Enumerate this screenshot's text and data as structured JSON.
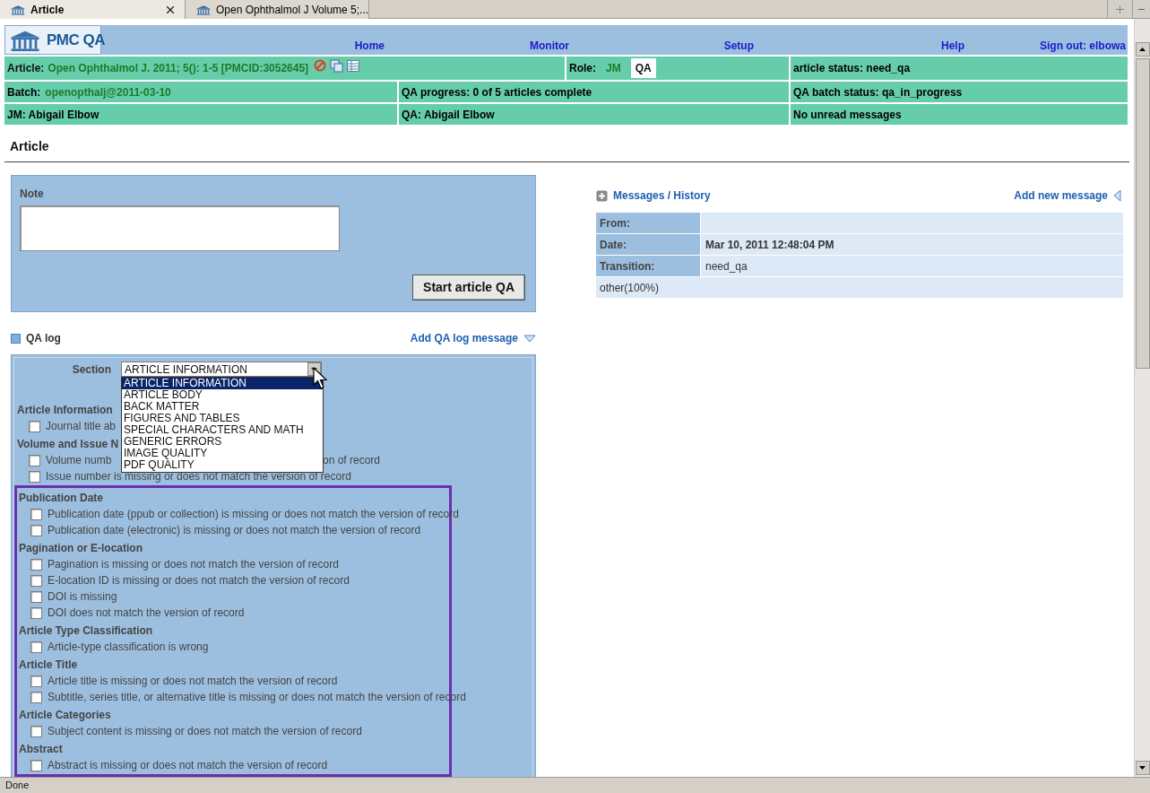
{
  "browser_tabs": [
    {
      "title": "Article",
      "selected": true
    },
    {
      "title": "Open Ophthalmol J Volume 5;...",
      "selected": false
    }
  ],
  "header": {
    "logo_text": "PMC QA",
    "nav": [
      "Home",
      "Monitor",
      "Setup",
      "Help",
      "Sign out: elbowa"
    ]
  },
  "info": {
    "article": {
      "label": "Article:",
      "value": "Open Ophthalmol J. 2011; 5(): 1-5 [PMCID:3052645]"
    },
    "role": {
      "label": "Role:",
      "options": [
        {
          "label": "JM",
          "selected": false
        },
        {
          "label": "QA",
          "selected": true
        }
      ]
    },
    "article_status": "article status: need_qa",
    "batch": {
      "label": "Batch:",
      "value": "openopthalj@2011-03-10"
    },
    "qa_progress": "QA progress: 0 of 5 articles complete",
    "qa_batch_status": "QA batch status: qa_in_progress",
    "jm": "JM: Abigail Elbow",
    "qa": "QA: Abigail Elbow",
    "messages_status": "No unread messages"
  },
  "page_title": "Article",
  "note": {
    "label": "Note",
    "button": "Start article QA"
  },
  "qa_log": {
    "title": "QA log",
    "add_link": "Add QA log message",
    "section_label": "Section",
    "section_select": {
      "value": "ARTICLE INFORMATION",
      "expanded": true,
      "options": [
        {
          "label": "ARTICLE INFORMATION",
          "selected": true
        },
        {
          "label": "ARTICLE BODY",
          "selected": false
        },
        {
          "label": "BACK MATTER",
          "selected": false
        },
        {
          "label": "FIGURES AND TABLES",
          "selected": false
        },
        {
          "label": "SPECIAL CHARACTERS AND MATH",
          "selected": false
        },
        {
          "label": "GENERIC ERRORS",
          "selected": false
        },
        {
          "label": "IMAGE QUALITY",
          "selected": false
        },
        {
          "label": "PDF QUALITY",
          "selected": false
        }
      ]
    },
    "sections": [
      {
        "heading": "Article Information",
        "highlighted": false,
        "items": [
          {
            "text": "Journal title ab",
            "checked": false
          }
        ]
      },
      {
        "heading": "Volume and Issue N",
        "highlighted": false,
        "items": [
          {
            "text": "Volume numb",
            "tail": "on of record",
            "checked": false
          },
          {
            "text": "Issue number is missing or does not match the version of record",
            "checked": false
          }
        ]
      },
      {
        "heading": "Publication Date",
        "highlighted": true,
        "items": [
          {
            "text": "Publication date (ppub or collection) is missing or does not match the version of record",
            "checked": false
          },
          {
            "text": "Publication date (electronic) is missing or does not match the version of record",
            "checked": false
          }
        ]
      },
      {
        "heading": "Pagination or E-location",
        "highlighted": true,
        "items": [
          {
            "text": "Pagination is missing or does not match the version of record",
            "checked": false
          },
          {
            "text": "E-location ID is missing or does not match the version of record",
            "checked": false
          },
          {
            "text": "DOI is missing",
            "checked": false
          },
          {
            "text": "DOI does not match the version of record",
            "checked": false
          }
        ]
      },
      {
        "heading": "Article Type Classification",
        "highlighted": true,
        "items": [
          {
            "text": "Article-type classification is wrong",
            "checked": false
          }
        ]
      },
      {
        "heading": "Article Title",
        "highlighted": true,
        "items": [
          {
            "text": "Article title is missing or does not match the version of record",
            "checked": false
          },
          {
            "text": "Subtitle, series title, or alternative title is missing or does not match the version of record",
            "checked": false
          }
        ]
      },
      {
        "heading": "Article Categories",
        "highlighted": true,
        "items": [
          {
            "text": "Subject content is missing or does not match the version of record",
            "checked": false
          }
        ]
      },
      {
        "heading": "Abstract",
        "highlighted": true,
        "items": [
          {
            "text": "Abstract is missing or does not match the version of record",
            "checked": false
          }
        ]
      }
    ]
  },
  "messages": {
    "title": "Messages / History",
    "add_link": "Add new message",
    "rows": [
      {
        "label": "From:",
        "value": ""
      },
      {
        "label": "Date:",
        "value": "Mar 10, 2011 12:48:04 PM"
      },
      {
        "label": "Transition:",
        "value": "need_qa"
      }
    ],
    "footer": "other(100%)"
  },
  "status_bar": "Done"
}
